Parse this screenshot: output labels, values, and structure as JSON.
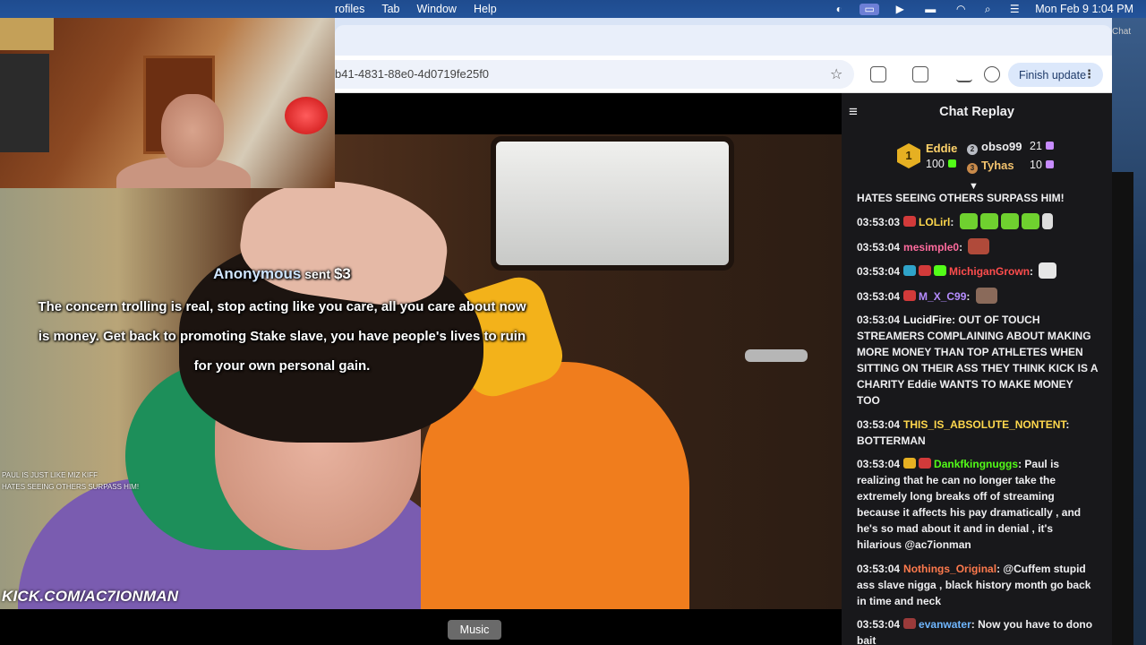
{
  "menubar": {
    "items": [
      "rofiles",
      "Tab",
      "Window",
      "Help"
    ],
    "datetime": "Mon Feb 9  1:04 PM"
  },
  "browser": {
    "url": "b41-4831-88e0-4d0719fe25f0",
    "finish_update_label": "Finish update",
    "right_tab_hint": "Chat"
  },
  "stream": {
    "donation_sender": "Anonymous",
    "donation_verb": " sent ",
    "donation_amount": "$3",
    "donation_message": "The concern trolling is real, stop acting like you care, all you care about now is money. Get back to promoting Stake slave, you have people's lives to ruin for your own personal gain.",
    "watermark": "KICK.COM/AC7IONMAN",
    "mini_chat": [
      "PAUL IS JUST LIKE MIZ KIFF",
      "HATES SEEING OTHERS SURPASS HIM!"
    ],
    "tooltip": "Music"
  },
  "chat": {
    "title": "Chat Replay",
    "leaderboard": {
      "first": {
        "name": "Eddie",
        "score": "100",
        "rank": "1"
      },
      "second": {
        "name": "obso99",
        "score": "21"
      },
      "third": {
        "name": "Tyhas",
        "score": "10"
      }
    },
    "messages": [
      {
        "ts": "03:53:03",
        "user": "",
        "text": "HATES SEEING OTHERS SURPASS HIM!",
        "color": "#efeff1",
        "partial": true
      },
      {
        "ts": "03:53:03",
        "user": "LOLirl",
        "text": ": ",
        "color": "#ffd84d",
        "emotes": 5
      },
      {
        "ts": "03:53:04",
        "user": "mesimple0",
        "text": ": ",
        "color": "#ff6b9e",
        "emotes": 1
      },
      {
        "ts": "03:53:04",
        "user": "MichiganGrown",
        "text": ": ",
        "color": "#ff4d4d",
        "emotes": 1
      },
      {
        "ts": "03:53:04",
        "user": "M_X_C99",
        "text": ": ",
        "color": "#b58cff",
        "emotes": 1
      },
      {
        "ts": "03:53:04",
        "user": "LucidFire",
        "text": ": OUT OF TOUCH STREAMERS COMPLAINING ABOUT MAKING MORE MONEY THAN TOP ATHLETES WHEN SITTING ON THEIR ASS  THEY THINK KICK IS A CHARITY  Eddie WANTS TO MAKE MONEY TOO",
        "color": "#ffffff"
      },
      {
        "ts": "03:53:04",
        "user": "THIS_IS_ABSOLUTE_NONTENT",
        "text": ": BOTTERMAN",
        "color": "#ffd84d"
      },
      {
        "ts": "03:53:04",
        "user": "Dankfkingnuggs",
        "text": ": Paul is realizing that he can no longer take the extremely long breaks off of streaming because it affects his pay dramatically , and he's so mad about it and in denial , it's hilarious @ac7ionman",
        "color": "#53fc18"
      },
      {
        "ts": "03:53:04",
        "user": "Nothings_Original",
        "text": ": @Cuffem stupid ass slave nigga , black history month go back in time and neck",
        "color": "#ff7a4d"
      },
      {
        "ts": "03:53:04",
        "user": "evanwater",
        "text": ": Now you have to dono bait",
        "color": "#6fb6ff"
      }
    ]
  },
  "colors": {
    "menubar": "#23539a",
    "chat_bg": "#18181b",
    "accent_green": "#53fc18",
    "gold": "#e6b022"
  }
}
